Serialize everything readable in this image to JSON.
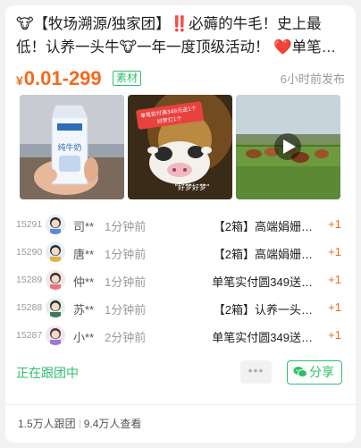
{
  "post": {
    "title": "🐮【牧场溯源/独家团】‼️必薅的牛毛！史上最低！认养一头牛🐮一年一度顶级活动！ ❤️单笔…",
    "price_currency": "¥",
    "price_range": "0.01-299",
    "tag": "素材",
    "posted_ago": "6小时前发布",
    "media": [
      {
        "name": "product-photo-milk",
        "icon": "milk-carton"
      },
      {
        "name": "product-photo-cow-lamp",
        "icon": "cow-lamp",
        "overlay_text": "单笔实付满349元送1个 好梦灯1个"
      },
      {
        "name": "video-thumbnail-ranch",
        "icon": "play-icon"
      }
    ]
  },
  "orders": [
    {
      "num": "15291",
      "name": "司**",
      "time": "1分钟前",
      "product": "【2箱】高端娟姗…",
      "qty": "+1"
    },
    {
      "num": "15290",
      "name": "唐**",
      "time": "1分钟前",
      "product": "【2箱】高端娟姗…",
      "qty": "+1"
    },
    {
      "num": "15289",
      "name": "仲**",
      "time": "1分钟前",
      "product": "单笔实付圆349送…",
      "qty": "+1"
    },
    {
      "num": "15288",
      "name": "苏**",
      "time": "1分钟前",
      "product": "【2箱】认养一头…",
      "qty": "+1"
    },
    {
      "num": "15287",
      "name": "小**",
      "time": "2分钟前",
      "product": "单笔实付圆349送…",
      "qty": "+1"
    }
  ],
  "actions": {
    "following_label": "正在跟团中",
    "more_label": "•••",
    "share_label": "分享"
  },
  "stats": {
    "followers": "1.5万人跟团",
    "views": "9.4万人查看"
  },
  "colors": {
    "accent_orange": "#f26b1d",
    "accent_green": "#2fbf6b"
  }
}
